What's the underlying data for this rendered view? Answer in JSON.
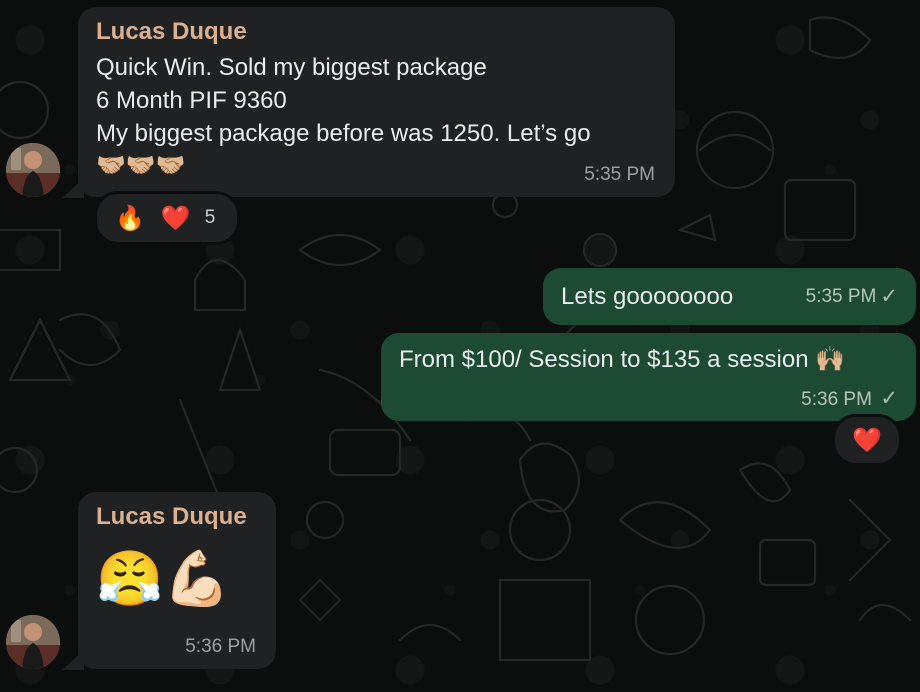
{
  "messages": [
    {
      "sender": "Lucas Duque",
      "lines": [
        "Quick Win. Sold my biggest package",
        "6 Month PIF 9360",
        "My biggest package before was 1250. Let’s go"
      ],
      "emoji_line": "🤝🏼🤝🏼🤝🏼",
      "time": "5:35 PM",
      "reactions": {
        "icons": [
          "🔥",
          "❤️"
        ],
        "count": "5"
      }
    },
    {
      "text": "Lets goooooooo",
      "time": "5:35 PM",
      "status": "✓"
    },
    {
      "text": "From $100/ Session to $135 a session 🙌🏼",
      "time": "5:36 PM",
      "status": "✓",
      "reactions": {
        "icons": [
          "❤️"
        ]
      }
    },
    {
      "sender": "Lucas Duque",
      "emoji_line": "😤💪🏻",
      "time": "5:36 PM"
    }
  ],
  "theme": {
    "incoming_bubble": "#202122",
    "outgoing_bubble": "#1d4a33",
    "sender_color": "#dcb08e",
    "background": "#0c0d0d"
  }
}
